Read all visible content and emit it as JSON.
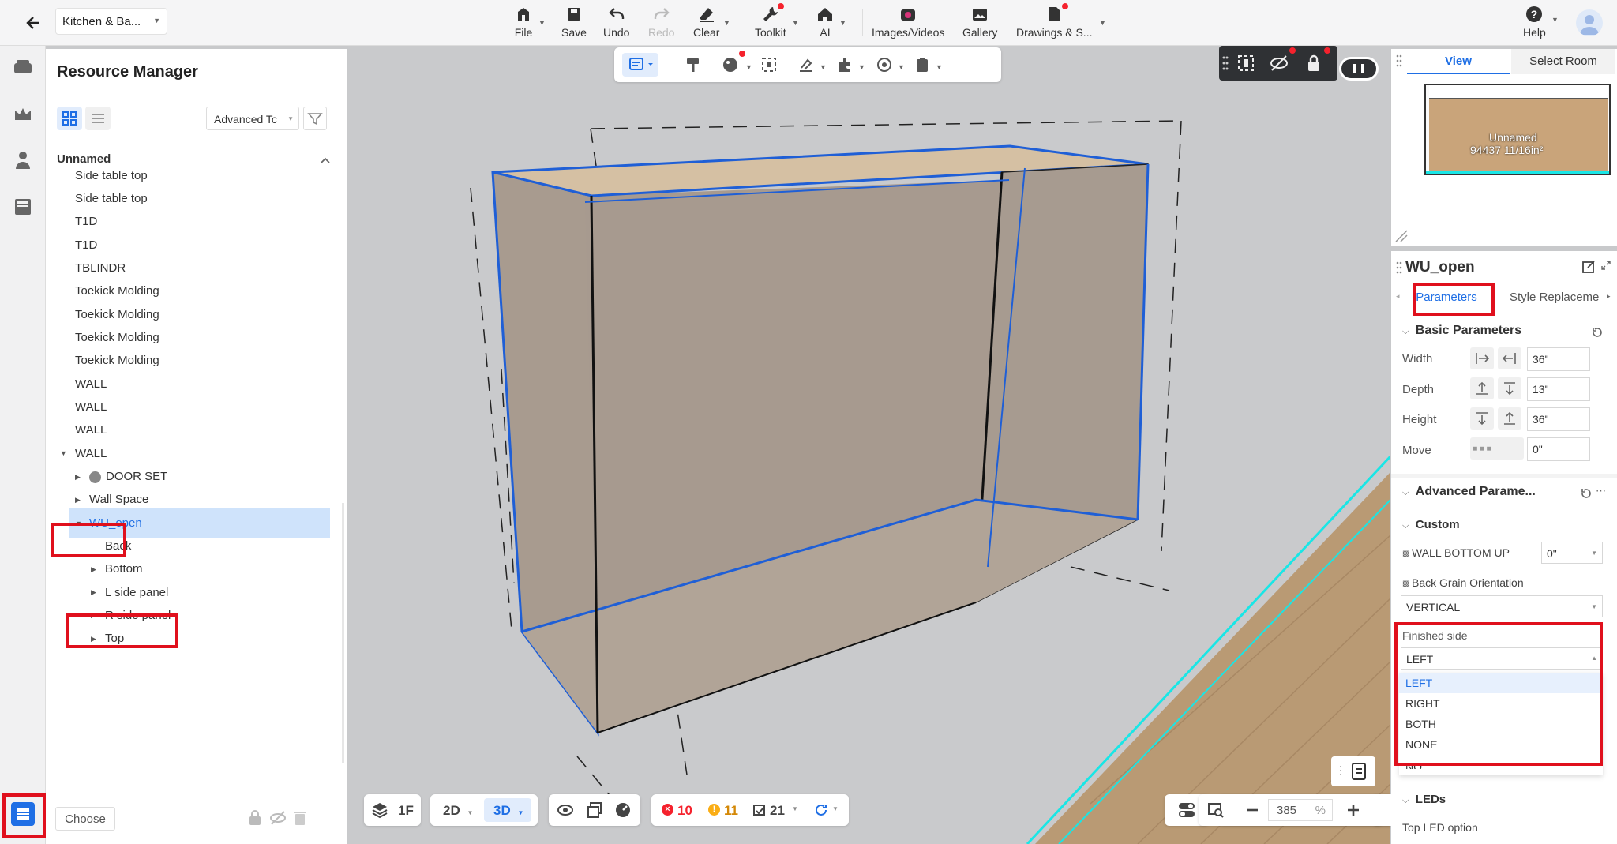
{
  "header": {
    "project_name": "Kitchen & Ba...",
    "tools": {
      "file": "File",
      "save": "Save",
      "undo": "Undo",
      "redo": "Redo",
      "clear": "Clear",
      "toolkit": "Toolkit",
      "ai": "AI",
      "images": "Images/Videos",
      "gallery": "Gallery",
      "drawings": "Drawings & S...",
      "help": "Help"
    }
  },
  "resource_manager": {
    "title": "Resource Manager",
    "filter_select": "Advanced Tc",
    "group_label": "Unnamed",
    "items": [
      "Side table top",
      "Side table top",
      "T1D",
      "T1D",
      "TBLINDR",
      "Toekick Molding",
      "Toekick Molding",
      "Toekick Molding",
      "Toekick Molding",
      "WALL",
      "WALL",
      "WALL",
      "WALL",
      "DOOR SET",
      "Wall Space",
      "WU_open",
      "Back",
      "Bottom",
      "L side panel",
      "R side panel",
      "Top"
    ],
    "choose_label": "Choose"
  },
  "bottom_bar": {
    "floor": "1F",
    "view_2d": "2D",
    "view_3d": "3D",
    "errors": "10",
    "warnings": "11",
    "count": "21",
    "zoom": "385",
    "zoom_unit": "%"
  },
  "minimap": {
    "tab_view": "View",
    "tab_select_room": "Select Room",
    "room_name": "Unnamed",
    "room_area": "94437 11/16in²"
  },
  "properties": {
    "object_name": "WU_open",
    "tab_parameters": "Parameters",
    "tab_style": "Style Replaceme",
    "basic_section": "Basic Parameters",
    "width_label": "Width",
    "width_value": "36\"",
    "depth_label": "Depth",
    "depth_value": "13\"",
    "height_label": "Height",
    "height_value": "36\"",
    "move_label": "Move",
    "move_value": "0\"",
    "advanced_section": "Advanced Parame...",
    "custom_section": "Custom",
    "wall_bottom_up_label": "WALL BOTTOM UP",
    "wall_bottom_up_value": "0\"",
    "back_grain_label": "Back Grain Orientation",
    "back_grain_value": "VERTICAL",
    "finished_side_label": "Finished side",
    "finished_side_value": "LEFT",
    "finished_side_options": [
      "LEFT",
      "RIGHT",
      "BOTH",
      "NONE",
      "NO"
    ],
    "leds_section": "LEDs",
    "top_led_label": "Top LED option"
  },
  "colors": {
    "accent": "#1f6fe5",
    "highlight": "#e0101d",
    "selected_row": "#cfe3fb",
    "cabinet_edge": "#1f5fd6"
  }
}
